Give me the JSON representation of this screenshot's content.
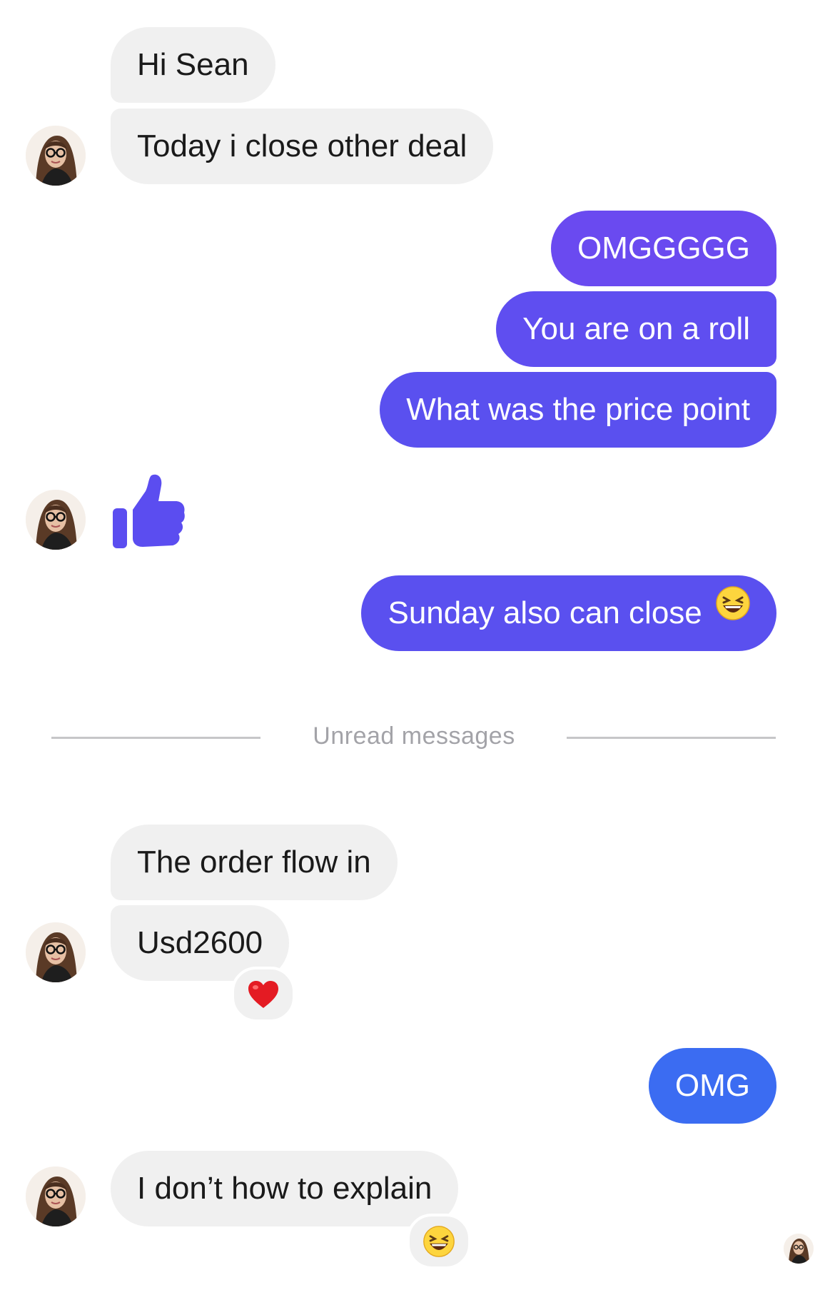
{
  "messages": {
    "m1": "Hi Sean",
    "m2": "Today i close other deal",
    "m3": "OMGGGGG",
    "m4": "You are on a roll",
    "m5": "What was the price point",
    "m6": "Sunday also can close",
    "m6_emoji": "laughing-emoji",
    "m7": "The order flow in",
    "m8": "Usd2600",
    "m8_reaction": "heart-emoji",
    "m9": "OMG",
    "m10": "I don’t how to explain",
    "m10_reaction": "laughing-emoji",
    "thumbs_up": "thumbs-up-icon"
  },
  "divider": {
    "label": "Unread messages"
  },
  "colors": {
    "incoming_bg": "#f0f0f0",
    "outgoing_purple": "#6e4af0",
    "outgoing_indigo": "#5a4ff0",
    "outgoing_blue": "#3b6cf2",
    "thumbs_up": "#5b4df0",
    "divider_text": "#a3a3a8"
  }
}
